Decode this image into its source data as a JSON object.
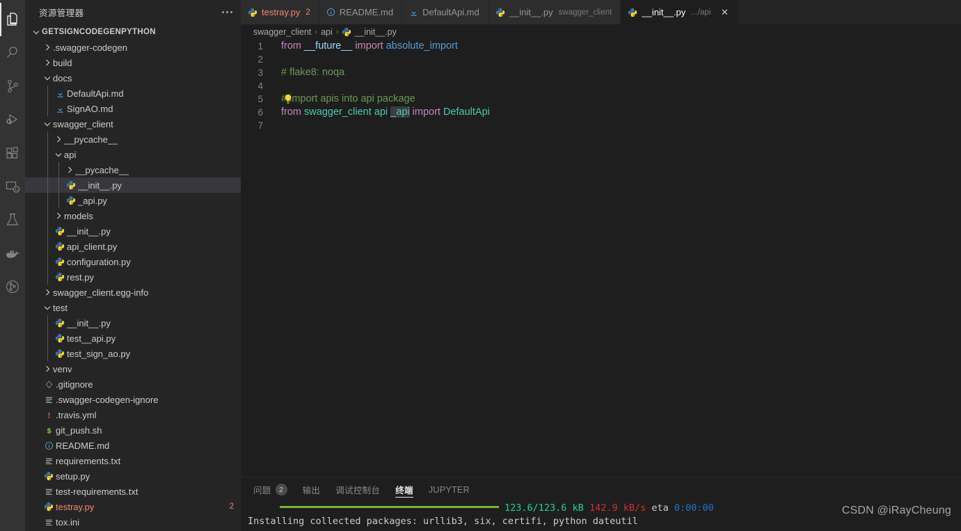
{
  "activity_bar": {
    "items": [
      {
        "name": "explorer-icon",
        "label": "资源管理器",
        "active": true
      },
      {
        "name": "search-icon",
        "label": "搜索",
        "active": false
      },
      {
        "name": "source-control-icon",
        "label": "源代码管理",
        "active": false
      },
      {
        "name": "run-debug-icon",
        "label": "运行和调试",
        "active": false
      },
      {
        "name": "extensions-icon",
        "label": "扩展",
        "active": false
      },
      {
        "name": "remote-explorer-icon",
        "label": "远程资源管理器",
        "active": false
      },
      {
        "name": "testing-flask-icon",
        "label": "测试",
        "active": false
      },
      {
        "name": "docker-icon",
        "label": "Docker",
        "active": false
      },
      {
        "name": "graph-icon",
        "label": "图形",
        "active": false
      }
    ]
  },
  "sidebar": {
    "title": "资源管理器",
    "more_actions": "...",
    "root": "GETSIGNCODEGENPYTHON",
    "tree": [
      {
        "label": "GETSIGNCODEGENPYTHON",
        "depth": 0,
        "kind": "root",
        "state": "expanded"
      },
      {
        "label": ".swagger-codegen",
        "depth": 1,
        "kind": "folder",
        "state": "collapsed"
      },
      {
        "label": "build",
        "depth": 1,
        "kind": "folder",
        "state": "collapsed"
      },
      {
        "label": "docs",
        "depth": 1,
        "kind": "folder",
        "state": "expanded"
      },
      {
        "label": "DefaultApi.md",
        "depth": 2,
        "kind": "markdown"
      },
      {
        "label": "SignAO.md",
        "depth": 2,
        "kind": "markdown"
      },
      {
        "label": "swagger_client",
        "depth": 1,
        "kind": "folder",
        "state": "expanded"
      },
      {
        "label": "__pycache__",
        "depth": 2,
        "kind": "folder",
        "state": "collapsed"
      },
      {
        "label": "api",
        "depth": 2,
        "kind": "folder",
        "state": "expanded"
      },
      {
        "label": "__pycache__",
        "depth": 3,
        "kind": "folder",
        "state": "collapsed"
      },
      {
        "label": "__init__.py",
        "depth": 3,
        "kind": "python",
        "selected": true
      },
      {
        "label": "_api.py",
        "depth": 3,
        "kind": "python"
      },
      {
        "label": "models",
        "depth": 2,
        "kind": "folder",
        "state": "collapsed"
      },
      {
        "label": "__init__.py",
        "depth": 2,
        "kind": "python"
      },
      {
        "label": "api_client.py",
        "depth": 2,
        "kind": "python"
      },
      {
        "label": "configuration.py",
        "depth": 2,
        "kind": "python"
      },
      {
        "label": "rest.py",
        "depth": 2,
        "kind": "python"
      },
      {
        "label": "swagger_client.egg-info",
        "depth": 1,
        "kind": "folder",
        "state": "collapsed"
      },
      {
        "label": "test",
        "depth": 1,
        "kind": "folder",
        "state": "expanded"
      },
      {
        "label": "__init__.py",
        "depth": 2,
        "kind": "python"
      },
      {
        "label": "test__api.py",
        "depth": 2,
        "kind": "python"
      },
      {
        "label": "test_sign_ao.py",
        "depth": 2,
        "kind": "python"
      },
      {
        "label": "venv",
        "depth": 1,
        "kind": "folder",
        "state": "collapsed"
      },
      {
        "label": ".gitignore",
        "depth": 1,
        "kind": "git"
      },
      {
        "label": ".swagger-codegen-ignore",
        "depth": 1,
        "kind": "text"
      },
      {
        "label": ".travis.yml",
        "depth": 1,
        "kind": "yaml"
      },
      {
        "label": "git_push.sh",
        "depth": 1,
        "kind": "shell"
      },
      {
        "label": "README.md",
        "depth": 1,
        "kind": "info"
      },
      {
        "label": "requirements.txt",
        "depth": 1,
        "kind": "text"
      },
      {
        "label": "setup.py",
        "depth": 1,
        "kind": "python"
      },
      {
        "label": "test-requirements.txt",
        "depth": 1,
        "kind": "text"
      },
      {
        "label": "testray.py",
        "depth": 1,
        "kind": "python",
        "error": true,
        "badge": "2"
      },
      {
        "label": "tox.ini",
        "depth": 1,
        "kind": "text"
      }
    ]
  },
  "tabs": [
    {
      "label": "testray.py",
      "icon": "python-icon",
      "badge": "2",
      "error": true,
      "active": false,
      "desc": ""
    },
    {
      "label": "README.md",
      "icon": "info-icon",
      "active": false,
      "desc": ""
    },
    {
      "label": "DefaultApi.md",
      "icon": "markdown-icon",
      "active": false,
      "desc": ""
    },
    {
      "label": "__init__.py",
      "icon": "python-icon",
      "active": false,
      "desc": "swagger_client"
    },
    {
      "label": "__init__.py",
      "icon": "python-icon",
      "active": true,
      "desc": ".../api",
      "close": "✕"
    }
  ],
  "breadcrumb": {
    "items": [
      "swagger_client",
      "api",
      "__init__.py"
    ],
    "separator": "›",
    "file_icon": "python-icon"
  },
  "editor": {
    "lines": [
      {
        "n": "1",
        "tokens": [
          {
            "t": "from ",
            "c": "kw"
          },
          {
            "t": "__future__",
            "c": "var"
          },
          {
            "t": " import ",
            "c": "kw"
          },
          {
            "t": "absolute_import",
            "c": "fn"
          }
        ]
      },
      {
        "n": "2",
        "tokens": []
      },
      {
        "n": "3",
        "tokens": [
          {
            "t": "# flake8: noqa",
            "c": "cm"
          }
        ]
      },
      {
        "n": "4",
        "tokens": []
      },
      {
        "n": "5",
        "bulb": true,
        "tokens": [
          {
            "t": "# import apis into api package",
            "c": "cm"
          }
        ]
      },
      {
        "n": "6",
        "tokens": [
          {
            "t": "from ",
            "c": "kw"
          },
          {
            "t": "swagger_client",
            "c": "cls"
          },
          {
            "t": ".",
            "c": "plain"
          },
          {
            "t": "api",
            "c": "cls"
          },
          {
            "t": ".",
            "c": "plain"
          },
          {
            "t": "_api",
            "c": "cls",
            "sel": true
          },
          {
            "t": " import ",
            "c": "kw"
          },
          {
            "t": "DefaultApi",
            "c": "cls"
          }
        ]
      },
      {
        "n": "7",
        "tokens": []
      }
    ]
  },
  "panel": {
    "tabs": [
      {
        "label": "问题",
        "badge": "2",
        "active": false
      },
      {
        "label": "输出",
        "active": false
      },
      {
        "label": "调试控制台",
        "active": false
      },
      {
        "label": "终端",
        "active": true
      },
      {
        "label": "JUPYTER",
        "active": false
      }
    ],
    "terminal": {
      "progress_line": {
        "bar": true,
        "size": "123.6/123.6 kB",
        "speed": "142.9 kB/s",
        "eta_label": "eta",
        "eta": "0:00:00"
      },
      "last_line": "Installing collected packages: urllib3, six, certifi, python dateutil"
    }
  },
  "watermark": "CSDN @iRayCheung",
  "colors": {
    "editor_bg": "#1e1e1e",
    "sidebar_bg": "#252526",
    "activitybar_bg": "#333333",
    "tab_inactive_bg": "#2d2d2d",
    "selection_bg": "#37373d",
    "error_fg": "#f48771",
    "keyword": "#C586C0",
    "class": "#4EC9B0",
    "comment": "#6A9955",
    "variable": "#9CDCFE",
    "function": "#569CD6",
    "python_blue": "#3572A5",
    "progress_green": "#7bb33a",
    "terminal_green": "#23d18b",
    "terminal_red": "#cd3131",
    "terminal_blue": "#2472c8"
  }
}
